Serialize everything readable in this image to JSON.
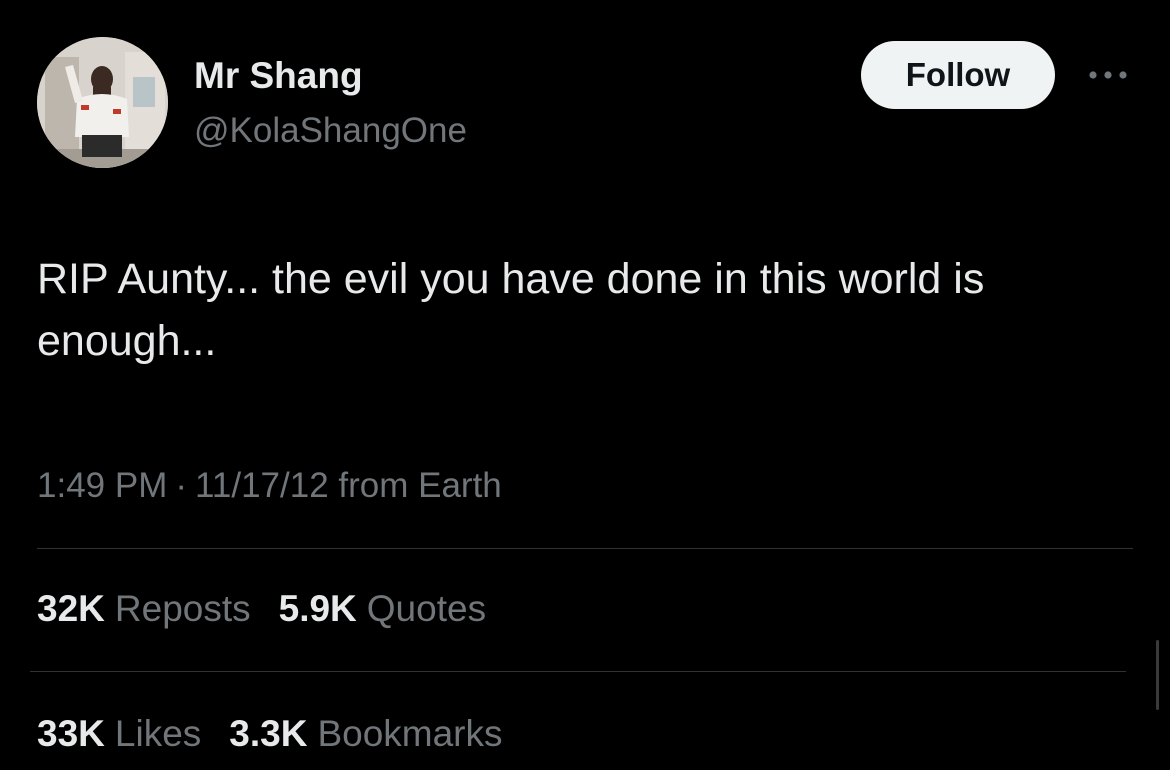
{
  "author": {
    "display_name": "Mr Shang",
    "handle": "@KolaShangOne",
    "avatar_icon": "profile-photo"
  },
  "actions": {
    "follow_label": "Follow",
    "more_icon": "more-horizontal-icon"
  },
  "tweet": {
    "text": "RIP Aunty... the evil you have done in this world is enough...",
    "time": "1:49 PM",
    "separator": "·",
    "date_source": "11/17/12 from Earth"
  },
  "stats": {
    "reposts": {
      "value": "32K",
      "label": "Reposts"
    },
    "quotes": {
      "value": "5.9K",
      "label": "Quotes"
    },
    "likes": {
      "value": "33K",
      "label": "Likes"
    },
    "bookmarks": {
      "value": "3.3K",
      "label": "Bookmarks"
    }
  },
  "colors": {
    "background": "#000000",
    "primary_text": "#e7e9ea",
    "secondary_text": "#71767b",
    "divider": "#2f3336",
    "follow_bg": "#eff3f4"
  }
}
